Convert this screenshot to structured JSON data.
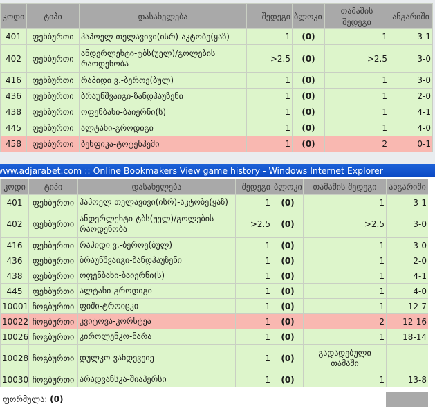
{
  "upper_table": {
    "headers": [
      "კოდი",
      "ტიპი",
      "დასახელება",
      "შედეგი",
      "ბლოკი",
      "თამაშის შედეგი",
      "ანგარიში"
    ],
    "rows": [
      {
        "code": "401",
        "type": "ფეხბურთი",
        "name": "ჰაპოელ თელავივი(ისრ)-აკტობე(ყაზ)",
        "result": "1",
        "block": "(0)",
        "game_result": "1",
        "score": "3-1",
        "state": "green"
      },
      {
        "code": "402",
        "type": "ფეხბურთი",
        "name": "ანდერლეხტი-ტბს(უელ)/გოლების რაოდენობა",
        "result": ">2.5",
        "block": "(0)",
        "game_result": ">2.5",
        "score": "3-0",
        "state": "green"
      },
      {
        "code": "416",
        "type": "ფეხბურთი",
        "name": "რაპიდი ვ.-ბეროე(ბულ)",
        "result": "1",
        "block": "(0)",
        "game_result": "1",
        "score": "3-0",
        "state": "green"
      },
      {
        "code": "436",
        "type": "ფეხბურთი",
        "name": "ბრაუნშვაიგი-ზანდჰაუზენი",
        "result": "1",
        "block": "(0)",
        "game_result": "1",
        "score": "2-0",
        "state": "green"
      },
      {
        "code": "438",
        "type": "ფეხბურთი",
        "name": "ოფენბახი-ბაიერნი(ს)",
        "result": "1",
        "block": "(0)",
        "game_result": "1",
        "score": "4-1",
        "state": "green"
      },
      {
        "code": "445",
        "type": "ფეხბურთი",
        "name": "ალტახი-გროდიგი",
        "result": "1",
        "block": "(0)",
        "game_result": "1",
        "score": "4-0",
        "state": "green"
      },
      {
        "code": "458",
        "type": "ფეხბურთი",
        "name": "ბენფიკა-ტოტენჰემი",
        "result": "1",
        "block": "(0)",
        "game_result": "2",
        "score": "0-1",
        "state": "red"
      }
    ]
  },
  "window_title": "www.adjarabet.com :: Online Bookmakers View game history - Windows Internet Explorer",
  "lower_table": {
    "headers": [
      "კოდი",
      "ტიპი",
      "დასახელება",
      "შედეგი",
      "ბლოკი",
      "თამაშის შედეგი",
      "ანგარიში"
    ],
    "rows": [
      {
        "code": "401",
        "type": "ფეხბურთი",
        "name": "ჰაპოელ თელავივი(ისრ)-აკტობე(ყაზ)",
        "result": "1",
        "block": "(0)",
        "game_result": "1",
        "score": "3-1",
        "state": "green"
      },
      {
        "code": "402",
        "type": "ფეხბურთი",
        "name": "ანდერლეხტი-ტბს(უელ)/გოლების რაოდენობა",
        "result": ">2.5",
        "block": "(0)",
        "game_result": ">2.5",
        "score": "3-0",
        "state": "green"
      },
      {
        "code": "416",
        "type": "ფეხბურთი",
        "name": "რაპიდი ვ.-ბეროე(ბულ)",
        "result": "1",
        "block": "(0)",
        "game_result": "1",
        "score": "3-0",
        "state": "green"
      },
      {
        "code": "436",
        "type": "ფეხბურთი",
        "name": "ბრაუნშვაიგი-ზანდჰაუზენი",
        "result": "1",
        "block": "(0)",
        "game_result": "1",
        "score": "2-0",
        "state": "green"
      },
      {
        "code": "438",
        "type": "ფეხბურთი",
        "name": "ოფენბახი-ბაიერნი(ს)",
        "result": "1",
        "block": "(0)",
        "game_result": "1",
        "score": "4-1",
        "state": "green"
      },
      {
        "code": "445",
        "type": "ფეხბურთი",
        "name": "ალტახი-გროდიგი",
        "result": "1",
        "block": "(0)",
        "game_result": "1",
        "score": "4-0",
        "state": "green"
      },
      {
        "code": "10001",
        "type": "ჩოგბურთი",
        "name": "ფიში-ტროიცკი",
        "result": "1",
        "block": "(0)",
        "game_result": "1",
        "score": "12-7",
        "state": "green"
      },
      {
        "code": "10022",
        "type": "ჩოგბურთი",
        "name": "კვიტოვა-კორსტეა",
        "result": "1",
        "block": "(0)",
        "game_result": "2",
        "score": "12-16",
        "state": "red"
      },
      {
        "code": "10026",
        "type": "ჩოგბურთი",
        "name": "კიროლენკო-ნარა",
        "result": "1",
        "block": "(0)",
        "game_result": "1",
        "score": "18-14",
        "state": "green"
      },
      {
        "code": "10028",
        "type": "ჩოგბურთი",
        "name": "დულკო-ვანდევეიე",
        "result": "1",
        "block": "(0)",
        "game_result": "გადადებული თამაში",
        "score": "",
        "state": "green"
      },
      {
        "code": "10030",
        "type": "ჩოგბურთი",
        "name": "არადვანსკა-შიაპერსი",
        "result": "1",
        "block": "(0)",
        "game_result": "1",
        "score": "13-8",
        "state": "green"
      }
    ]
  },
  "footer": {
    "label": "ფორმულა:",
    "value": "(0)"
  }
}
